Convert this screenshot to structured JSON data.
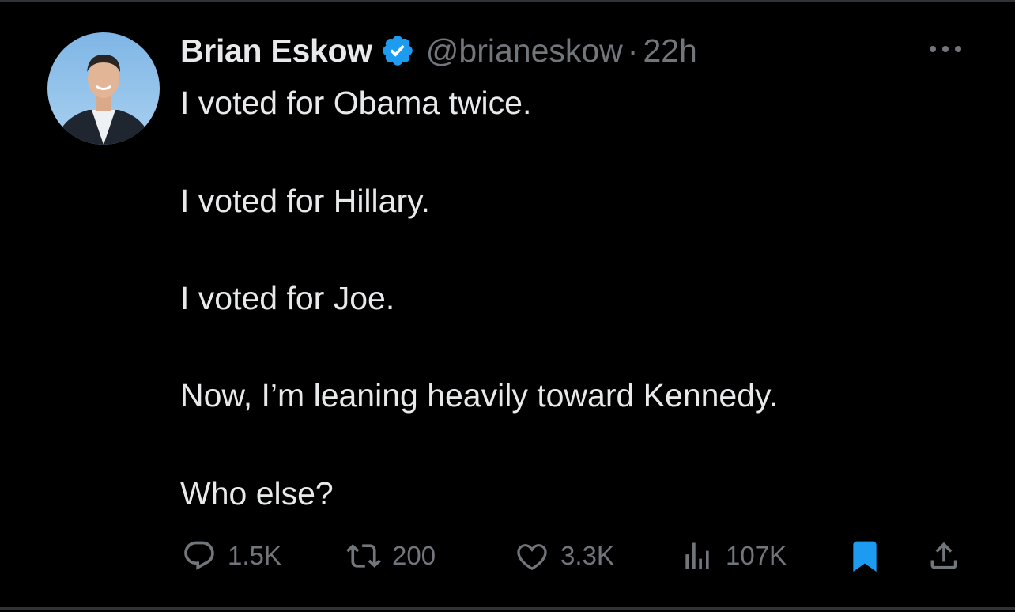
{
  "tweet": {
    "display_name": "Brian Eskow",
    "handle": "@brianeskow",
    "separator": "·",
    "time": "22h",
    "lines": [
      "I voted for Obama twice.",
      "I voted for Hillary.",
      "I voted for Joe.",
      "Now, I’m leaning heavily toward Kennedy.",
      "Who else?"
    ]
  },
  "actions": {
    "replies": "1.5K",
    "reposts": "200",
    "likes": "3.3K",
    "views": "107K"
  },
  "icons": {
    "verified": "verified-badge-icon",
    "more": "more-options-icon",
    "reply": "reply-icon",
    "repost": "repost-icon",
    "like": "heart-icon",
    "views": "views-chart-icon",
    "bookmark": "bookmark-icon",
    "share": "share-icon"
  },
  "colors": {
    "background": "#000000",
    "text": "#e7e9ea",
    "secondary": "#71767b",
    "accent": "#1d9bf0"
  }
}
